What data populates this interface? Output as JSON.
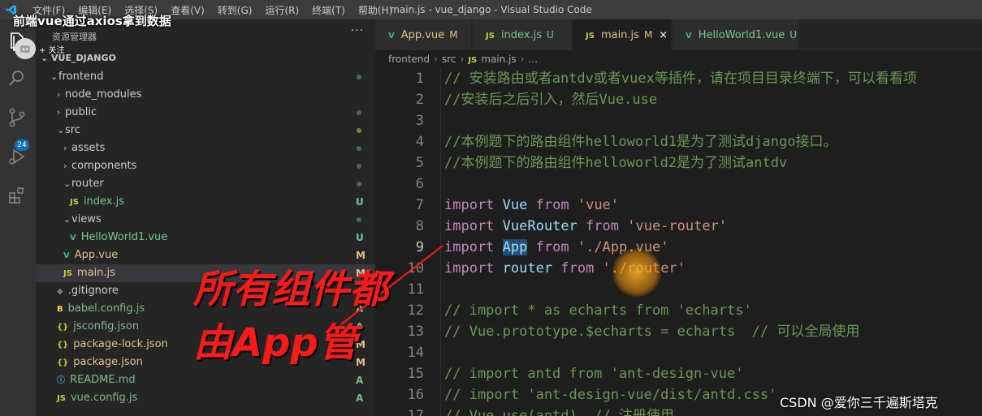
{
  "window": {
    "title": "main.js - vue_django - Visual Studio Code",
    "video_title": "前端vue通过axios拿到数据",
    "menu": [
      "文件(F)",
      "编辑(E)",
      "选择(S)",
      "查看(V)",
      "转到(G)",
      "运行(R)",
      "终端(T)",
      "帮助(H)"
    ]
  },
  "follow": {
    "label": "+ 关注"
  },
  "activity": {
    "scm_badge": "24"
  },
  "sidebar": {
    "header": "资源管理器",
    "more": "···",
    "section": "VUE_DJANGO",
    "tree": [
      {
        "label": "frontend",
        "kind": "folder-open",
        "depth": 0,
        "dot": "git"
      },
      {
        "label": "node_modules",
        "kind": "folder",
        "depth": 1
      },
      {
        "label": "public",
        "kind": "folder",
        "depth": 1,
        "dot": "git"
      },
      {
        "label": "src",
        "kind": "folder-open",
        "depth": 1,
        "dot": "mod"
      },
      {
        "label": "assets",
        "kind": "folder",
        "depth": 2,
        "dot": "git"
      },
      {
        "label": "components",
        "kind": "folder",
        "depth": 2,
        "dot": "git"
      },
      {
        "label": "router",
        "kind": "folder-open",
        "depth": 2,
        "dot": "git"
      },
      {
        "label": "index.js",
        "kind": "js",
        "depth": 3,
        "status": "U"
      },
      {
        "label": "views",
        "kind": "folder-open",
        "depth": 2,
        "dot": "git"
      },
      {
        "label": "HelloWorld1.vue",
        "kind": "vue",
        "depth": 3,
        "status": "U"
      },
      {
        "label": "App.vue",
        "kind": "vue",
        "depth": 2,
        "status": "M"
      },
      {
        "label": "main.js",
        "kind": "js",
        "depth": 2,
        "status": "M",
        "selected": true
      },
      {
        "label": ".gitignore",
        "kind": "git",
        "depth": 1
      },
      {
        "label": "babel.config.js",
        "kind": "babel",
        "depth": 1,
        "status": "A"
      },
      {
        "label": "jsconfig.json",
        "kind": "json",
        "depth": 1,
        "status": "A"
      },
      {
        "label": "package-lock.json",
        "kind": "json",
        "depth": 1,
        "status": "M"
      },
      {
        "label": "package.json",
        "kind": "json",
        "depth": 1,
        "status": "M"
      },
      {
        "label": "README.md",
        "kind": "info",
        "depth": 1,
        "status": "A"
      },
      {
        "label": "vue.config.js",
        "kind": "js",
        "depth": 1,
        "status": "A"
      }
    ]
  },
  "tabs": [
    {
      "label": "App.vue",
      "kind": "vue",
      "flag": "M"
    },
    {
      "label": "index.js",
      "kind": "js",
      "flag": "U"
    },
    {
      "label": "main.js",
      "kind": "js",
      "flag": "M",
      "active": true,
      "close": "×"
    },
    {
      "label": "HelloWorld1.vue",
      "kind": "vue",
      "flag": "U"
    }
  ],
  "breadcrumb": [
    "frontend",
    "src",
    "main.js",
    "..."
  ],
  "icons": {
    "js": "JS",
    "vue": "V",
    "json": "{}",
    "info": "ⓘ",
    "git": "◆",
    "babel": "B",
    "folder": "›",
    "folder-open": "⌄"
  },
  "editor": {
    "lines": [
      {
        "n": "1",
        "parts": [
          {
            "c": "c",
            "t": "// 安装路由或者antdv或者vuex等插件，请在项目目录终端下，可以看看项"
          }
        ]
      },
      {
        "n": "2",
        "parts": [
          {
            "c": "c",
            "t": "//安装后之后引入，然后Vue.use"
          }
        ]
      },
      {
        "n": "3",
        "parts": []
      },
      {
        "n": "4",
        "parts": [
          {
            "c": "c",
            "t": "//本例题下的路由组件helloworld1是为了测试django接口。"
          }
        ]
      },
      {
        "n": "5",
        "parts": [
          {
            "c": "c",
            "t": "//本例题下的路由组件helloworld2是为了测试antdv"
          }
        ]
      },
      {
        "n": "6",
        "parts": []
      },
      {
        "n": "7",
        "parts": [
          {
            "c": "k",
            "t": "import"
          },
          {
            "c": "",
            "t": " "
          },
          {
            "c": "t",
            "t": "Vue"
          },
          {
            "c": "",
            "t": " "
          },
          {
            "c": "k",
            "t": "from"
          },
          {
            "c": "",
            "t": " "
          },
          {
            "c": "s",
            "t": "'vue'"
          }
        ]
      },
      {
        "n": "8",
        "parts": [
          {
            "c": "k",
            "t": "import"
          },
          {
            "c": "",
            "t": " "
          },
          {
            "c": "t",
            "t": "VueRouter"
          },
          {
            "c": "",
            "t": " "
          },
          {
            "c": "k",
            "t": "from"
          },
          {
            "c": "",
            "t": " "
          },
          {
            "c": "s",
            "t": "'vue-router'"
          }
        ]
      },
      {
        "n": "9",
        "parts": [
          {
            "c": "k",
            "t": "import"
          },
          {
            "c": "",
            "t": " "
          },
          {
            "c": "t sel",
            "t": "App"
          },
          {
            "c": "",
            "t": " "
          },
          {
            "c": "k",
            "t": "from"
          },
          {
            "c": "",
            "t": " "
          },
          {
            "c": "s",
            "t": "'./App.vue'"
          }
        ]
      },
      {
        "n": "10",
        "parts": [
          {
            "c": "k",
            "t": "import"
          },
          {
            "c": "",
            "t": " "
          },
          {
            "c": "t",
            "t": "router"
          },
          {
            "c": "",
            "t": " "
          },
          {
            "c": "k",
            "t": "from"
          },
          {
            "c": "",
            "t": " "
          },
          {
            "c": "s",
            "t": "'./router'"
          }
        ]
      },
      {
        "n": "11",
        "parts": []
      },
      {
        "n": "12",
        "parts": [
          {
            "c": "c",
            "t": "// import * as echarts from 'echarts'"
          }
        ]
      },
      {
        "n": "13",
        "parts": [
          {
            "c": "c",
            "t": "// Vue.prototype.$echarts = echarts  // 可以全局使用"
          }
        ]
      },
      {
        "n": "14",
        "parts": []
      },
      {
        "n": "15",
        "parts": [
          {
            "c": "c",
            "t": "// import antd from 'ant-design-vue'"
          }
        ]
      },
      {
        "n": "16",
        "parts": [
          {
            "c": "c",
            "t": "// import 'ant-design-vue/dist/antd.css'"
          }
        ]
      },
      {
        "n": "17",
        "parts": [
          {
            "c": "c",
            "t": "// Vue.use(antd)  // 注册使用"
          }
        ]
      }
    ]
  },
  "annotation": {
    "line1": "所有组件都",
    "line2": "由App管",
    "color": "#ff1a1a"
  },
  "watermark": "CSDN @爱你三千遍斯塔克",
  "colors": {
    "vue": "#41b883",
    "js": "#cbcb41",
    "json": "#cbcb41",
    "info": "#519aba",
    "git": "#6d8086",
    "babel": "#f5da55",
    "U": "#73c991",
    "M": "#e2c08d",
    "A": "#81b88b"
  }
}
